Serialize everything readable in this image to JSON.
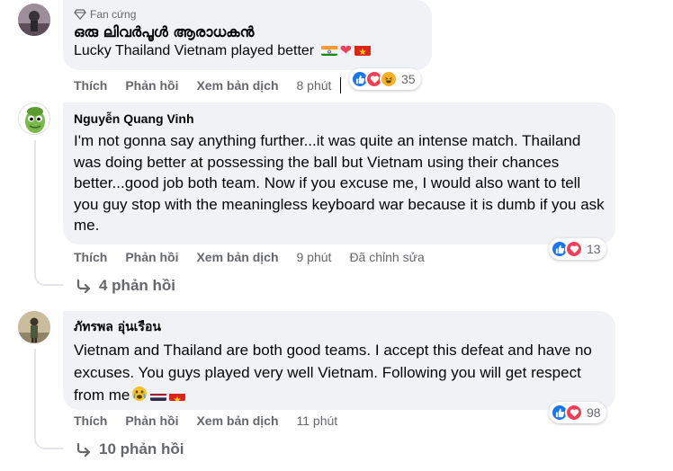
{
  "comments": [
    {
      "badge": "Fan cứng",
      "author": "ഒരു ലിവർപൂൾ ആരാധകൻ",
      "text": "Lucky Thailand Vietnam played better",
      "actions": {
        "like": "Thích",
        "reply": "Phản hồi",
        "translate": "Xem bản dịch",
        "time": "8 phút"
      },
      "reactions": {
        "count": "35",
        "icons": [
          "like-icon",
          "love-icon",
          "haha-icon"
        ]
      }
    },
    {
      "author": "Nguyễn Quang Vinh",
      "text": "I'm not gonna say anything further...it was quite an intense match. Thailand was doing better at possessing the ball but Vietnam using their chances better...good job both team. Now if you excuse me, I would also want to tell you guy stop with the meaningless keyboard war because it is dumb if you ask me.",
      "actions": {
        "like": "Thích",
        "reply": "Phản hồi",
        "translate": "Xem bản dịch",
        "time": "9 phút",
        "edited": "Đã chỉnh sửa"
      },
      "reactions": {
        "count": "13",
        "icons": [
          "like-icon",
          "love-icon"
        ]
      },
      "replies": "4 phản hồi"
    },
    {
      "author": "ภัทรพล อุ่นเรือน",
      "text": "Vietnam and Thailand are both good teams. I accept this defeat and have no excuses. You guys played very well Vietnam. Following you will get respect from me",
      "actions": {
        "like": "Thích",
        "reply": "Phản hồi",
        "translate": "Xem bản dịch",
        "time": "11 phút"
      },
      "reactions": {
        "count": "98",
        "icons": [
          "like-icon",
          "love-icon"
        ]
      },
      "replies": "10 phản hồi"
    }
  ],
  "colors": {
    "bubble": "#f0f2f5",
    "meta": "#65676b",
    "like": "#1877f2",
    "love": "#f33e58",
    "haha": "#f7b125"
  }
}
